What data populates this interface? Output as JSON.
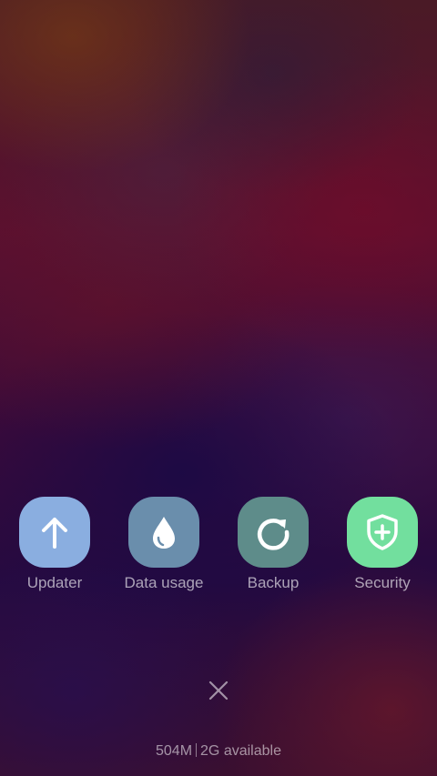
{
  "toggles": [
    {
      "id": "updater",
      "label": "Updater",
      "icon": "arrow-up-icon",
      "color": "#8aaee0"
    },
    {
      "id": "data-usage",
      "label": "Data usage",
      "icon": "water-drop-icon",
      "color": "#6a8eac"
    },
    {
      "id": "backup",
      "label": "Backup",
      "icon": "refresh-icon",
      "color": "#5e8c8a"
    },
    {
      "id": "security",
      "label": "Security",
      "icon": "shield-plus-icon",
      "color": "#72df9e"
    }
  ],
  "close": {
    "icon": "close-icon"
  },
  "memory": {
    "free": "504M",
    "available": "2G available"
  }
}
